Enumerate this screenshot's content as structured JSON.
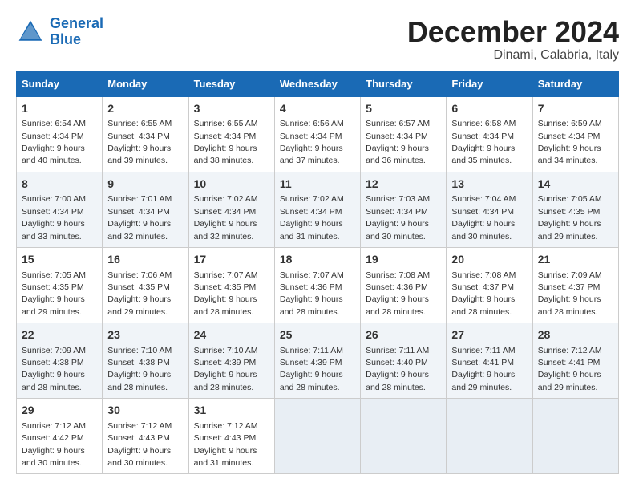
{
  "logo": {
    "line1": "General",
    "line2": "Blue"
  },
  "title": "December 2024",
  "subtitle": "Dinami, Calabria, Italy",
  "header": {
    "days": [
      "Sunday",
      "Monday",
      "Tuesday",
      "Wednesday",
      "Thursday",
      "Friday",
      "Saturday"
    ]
  },
  "weeks": [
    [
      {
        "day": "1",
        "sunrise": "Sunrise: 6:54 AM",
        "sunset": "Sunset: 4:34 PM",
        "daylight": "Daylight: 9 hours and 40 minutes."
      },
      {
        "day": "2",
        "sunrise": "Sunrise: 6:55 AM",
        "sunset": "Sunset: 4:34 PM",
        "daylight": "Daylight: 9 hours and 39 minutes."
      },
      {
        "day": "3",
        "sunrise": "Sunrise: 6:55 AM",
        "sunset": "Sunset: 4:34 PM",
        "daylight": "Daylight: 9 hours and 38 minutes."
      },
      {
        "day": "4",
        "sunrise": "Sunrise: 6:56 AM",
        "sunset": "Sunset: 4:34 PM",
        "daylight": "Daylight: 9 hours and 37 minutes."
      },
      {
        "day": "5",
        "sunrise": "Sunrise: 6:57 AM",
        "sunset": "Sunset: 4:34 PM",
        "daylight": "Daylight: 9 hours and 36 minutes."
      },
      {
        "day": "6",
        "sunrise": "Sunrise: 6:58 AM",
        "sunset": "Sunset: 4:34 PM",
        "daylight": "Daylight: 9 hours and 35 minutes."
      },
      {
        "day": "7",
        "sunrise": "Sunrise: 6:59 AM",
        "sunset": "Sunset: 4:34 PM",
        "daylight": "Daylight: 9 hours and 34 minutes."
      }
    ],
    [
      {
        "day": "8",
        "sunrise": "Sunrise: 7:00 AM",
        "sunset": "Sunset: 4:34 PM",
        "daylight": "Daylight: 9 hours and 33 minutes."
      },
      {
        "day": "9",
        "sunrise": "Sunrise: 7:01 AM",
        "sunset": "Sunset: 4:34 PM",
        "daylight": "Daylight: 9 hours and 32 minutes."
      },
      {
        "day": "10",
        "sunrise": "Sunrise: 7:02 AM",
        "sunset": "Sunset: 4:34 PM",
        "daylight": "Daylight: 9 hours and 32 minutes."
      },
      {
        "day": "11",
        "sunrise": "Sunrise: 7:02 AM",
        "sunset": "Sunset: 4:34 PM",
        "daylight": "Daylight: 9 hours and 31 minutes."
      },
      {
        "day": "12",
        "sunrise": "Sunrise: 7:03 AM",
        "sunset": "Sunset: 4:34 PM",
        "daylight": "Daylight: 9 hours and 30 minutes."
      },
      {
        "day": "13",
        "sunrise": "Sunrise: 7:04 AM",
        "sunset": "Sunset: 4:34 PM",
        "daylight": "Daylight: 9 hours and 30 minutes."
      },
      {
        "day": "14",
        "sunrise": "Sunrise: 7:05 AM",
        "sunset": "Sunset: 4:35 PM",
        "daylight": "Daylight: 9 hours and 29 minutes."
      }
    ],
    [
      {
        "day": "15",
        "sunrise": "Sunrise: 7:05 AM",
        "sunset": "Sunset: 4:35 PM",
        "daylight": "Daylight: 9 hours and 29 minutes."
      },
      {
        "day": "16",
        "sunrise": "Sunrise: 7:06 AM",
        "sunset": "Sunset: 4:35 PM",
        "daylight": "Daylight: 9 hours and 29 minutes."
      },
      {
        "day": "17",
        "sunrise": "Sunrise: 7:07 AM",
        "sunset": "Sunset: 4:35 PM",
        "daylight": "Daylight: 9 hours and 28 minutes."
      },
      {
        "day": "18",
        "sunrise": "Sunrise: 7:07 AM",
        "sunset": "Sunset: 4:36 PM",
        "daylight": "Daylight: 9 hours and 28 minutes."
      },
      {
        "day": "19",
        "sunrise": "Sunrise: 7:08 AM",
        "sunset": "Sunset: 4:36 PM",
        "daylight": "Daylight: 9 hours and 28 minutes."
      },
      {
        "day": "20",
        "sunrise": "Sunrise: 7:08 AM",
        "sunset": "Sunset: 4:37 PM",
        "daylight": "Daylight: 9 hours and 28 minutes."
      },
      {
        "day": "21",
        "sunrise": "Sunrise: 7:09 AM",
        "sunset": "Sunset: 4:37 PM",
        "daylight": "Daylight: 9 hours and 28 minutes."
      }
    ],
    [
      {
        "day": "22",
        "sunrise": "Sunrise: 7:09 AM",
        "sunset": "Sunset: 4:38 PM",
        "daylight": "Daylight: 9 hours and 28 minutes."
      },
      {
        "day": "23",
        "sunrise": "Sunrise: 7:10 AM",
        "sunset": "Sunset: 4:38 PM",
        "daylight": "Daylight: 9 hours and 28 minutes."
      },
      {
        "day": "24",
        "sunrise": "Sunrise: 7:10 AM",
        "sunset": "Sunset: 4:39 PM",
        "daylight": "Daylight: 9 hours and 28 minutes."
      },
      {
        "day": "25",
        "sunrise": "Sunrise: 7:11 AM",
        "sunset": "Sunset: 4:39 PM",
        "daylight": "Daylight: 9 hours and 28 minutes."
      },
      {
        "day": "26",
        "sunrise": "Sunrise: 7:11 AM",
        "sunset": "Sunset: 4:40 PM",
        "daylight": "Daylight: 9 hours and 28 minutes."
      },
      {
        "day": "27",
        "sunrise": "Sunrise: 7:11 AM",
        "sunset": "Sunset: 4:41 PM",
        "daylight": "Daylight: 9 hours and 29 minutes."
      },
      {
        "day": "28",
        "sunrise": "Sunrise: 7:12 AM",
        "sunset": "Sunset: 4:41 PM",
        "daylight": "Daylight: 9 hours and 29 minutes."
      }
    ],
    [
      {
        "day": "29",
        "sunrise": "Sunrise: 7:12 AM",
        "sunset": "Sunset: 4:42 PM",
        "daylight": "Daylight: 9 hours and 30 minutes."
      },
      {
        "day": "30",
        "sunrise": "Sunrise: 7:12 AM",
        "sunset": "Sunset: 4:43 PM",
        "daylight": "Daylight: 9 hours and 30 minutes."
      },
      {
        "day": "31",
        "sunrise": "Sunrise: 7:12 AM",
        "sunset": "Sunset: 4:43 PM",
        "daylight": "Daylight: 9 hours and 31 minutes."
      },
      null,
      null,
      null,
      null
    ]
  ]
}
